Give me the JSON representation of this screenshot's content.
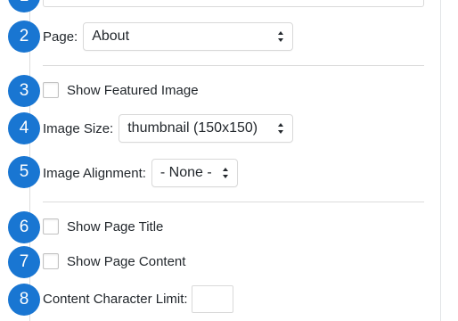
{
  "steps": [
    {
      "num": "1"
    },
    {
      "num": "2"
    },
    {
      "num": "3"
    },
    {
      "num": "4"
    },
    {
      "num": "5"
    },
    {
      "num": "6"
    },
    {
      "num": "7"
    },
    {
      "num": "8"
    }
  ],
  "page_field": {
    "label": "Page:",
    "selected": "About"
  },
  "show_featured_image": {
    "label": "Show Featured Image",
    "checked": false
  },
  "image_size": {
    "label": "Image Size:",
    "selected": "thumbnail (150x150)"
  },
  "image_alignment": {
    "label": "Image Alignment:",
    "selected": "- None -"
  },
  "show_page_title": {
    "label": "Show Page Title",
    "checked": false
  },
  "show_page_content": {
    "label": "Show Page Content",
    "checked": false
  },
  "content_char_limit": {
    "label": "Content Character Limit:",
    "value": ""
  },
  "colors": {
    "badge": "#1976d2",
    "border": "#d9d9d9",
    "divider": "#dcdcdc"
  }
}
